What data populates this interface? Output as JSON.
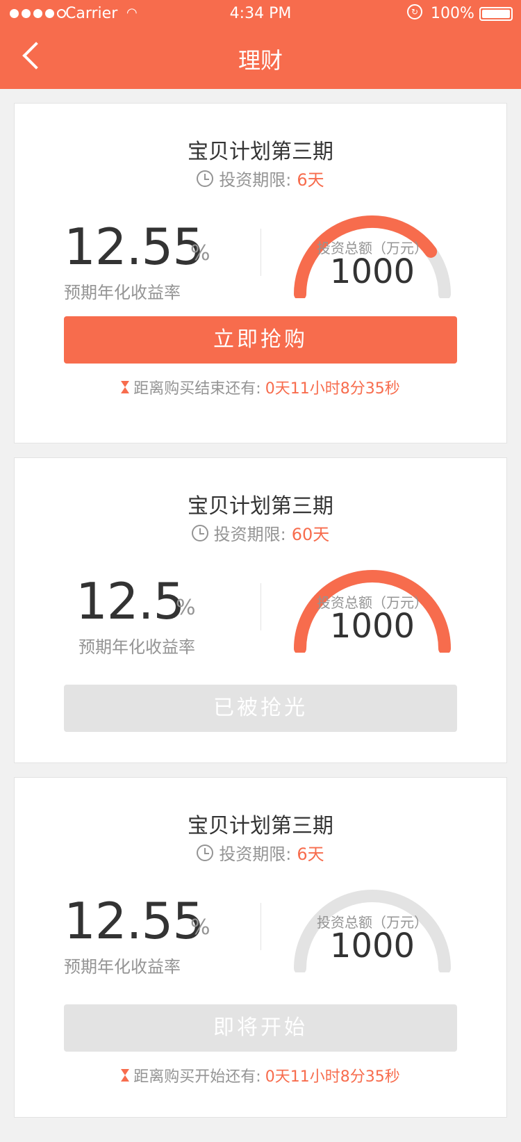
{
  "status_bar": {
    "carrier": "Carrier",
    "time": "4:34 PM",
    "battery": "100%"
  },
  "nav": {
    "title": "理财"
  },
  "cards": [
    {
      "title": "宝贝计划第三期",
      "term_label": "投资期限:",
      "term_value": "6天",
      "rate_value": "12.55",
      "rate_unit": "%",
      "rate_label": "预期年化收益率",
      "total_label": "投资总额（万元）",
      "total_value": "1000",
      "progress": 0.8,
      "button": "立即抢购",
      "button_state": "active",
      "countdown_label": "距离购买结束还有:",
      "countdown_value": "0天11小时8分35秒"
    },
    {
      "title": "宝贝计划第三期",
      "term_label": "投资期限:",
      "term_value": "60天",
      "rate_value": "12.5",
      "rate_unit": "%",
      "rate_label": "预期年化收益率",
      "total_label": "投资总额（万元）",
      "total_value": "1000",
      "progress": 1.0,
      "button": "已被抢光",
      "button_state": "disabled"
    },
    {
      "title": "宝贝计划第三期",
      "term_label": "投资期限:",
      "term_value": "6天",
      "rate_value": "12.55",
      "rate_unit": "%",
      "rate_label": "预期年化收益率",
      "total_label": "投资总额（万元）",
      "total_value": "1000",
      "progress": 0.0,
      "button": "即将开始",
      "button_state": "disabled",
      "countdown_label": "距离购买开始还有:",
      "countdown_value": "0天11小时8分35秒"
    }
  ],
  "colors": {
    "accent": "#f76c4d",
    "text_dark": "#333333",
    "text_gray": "#949494",
    "track": "#e3e3e3"
  },
  "icons": [
    "back-icon",
    "clock-icon",
    "hourglass-icon",
    "wifi-icon",
    "lock-icon",
    "battery-icon"
  ]
}
